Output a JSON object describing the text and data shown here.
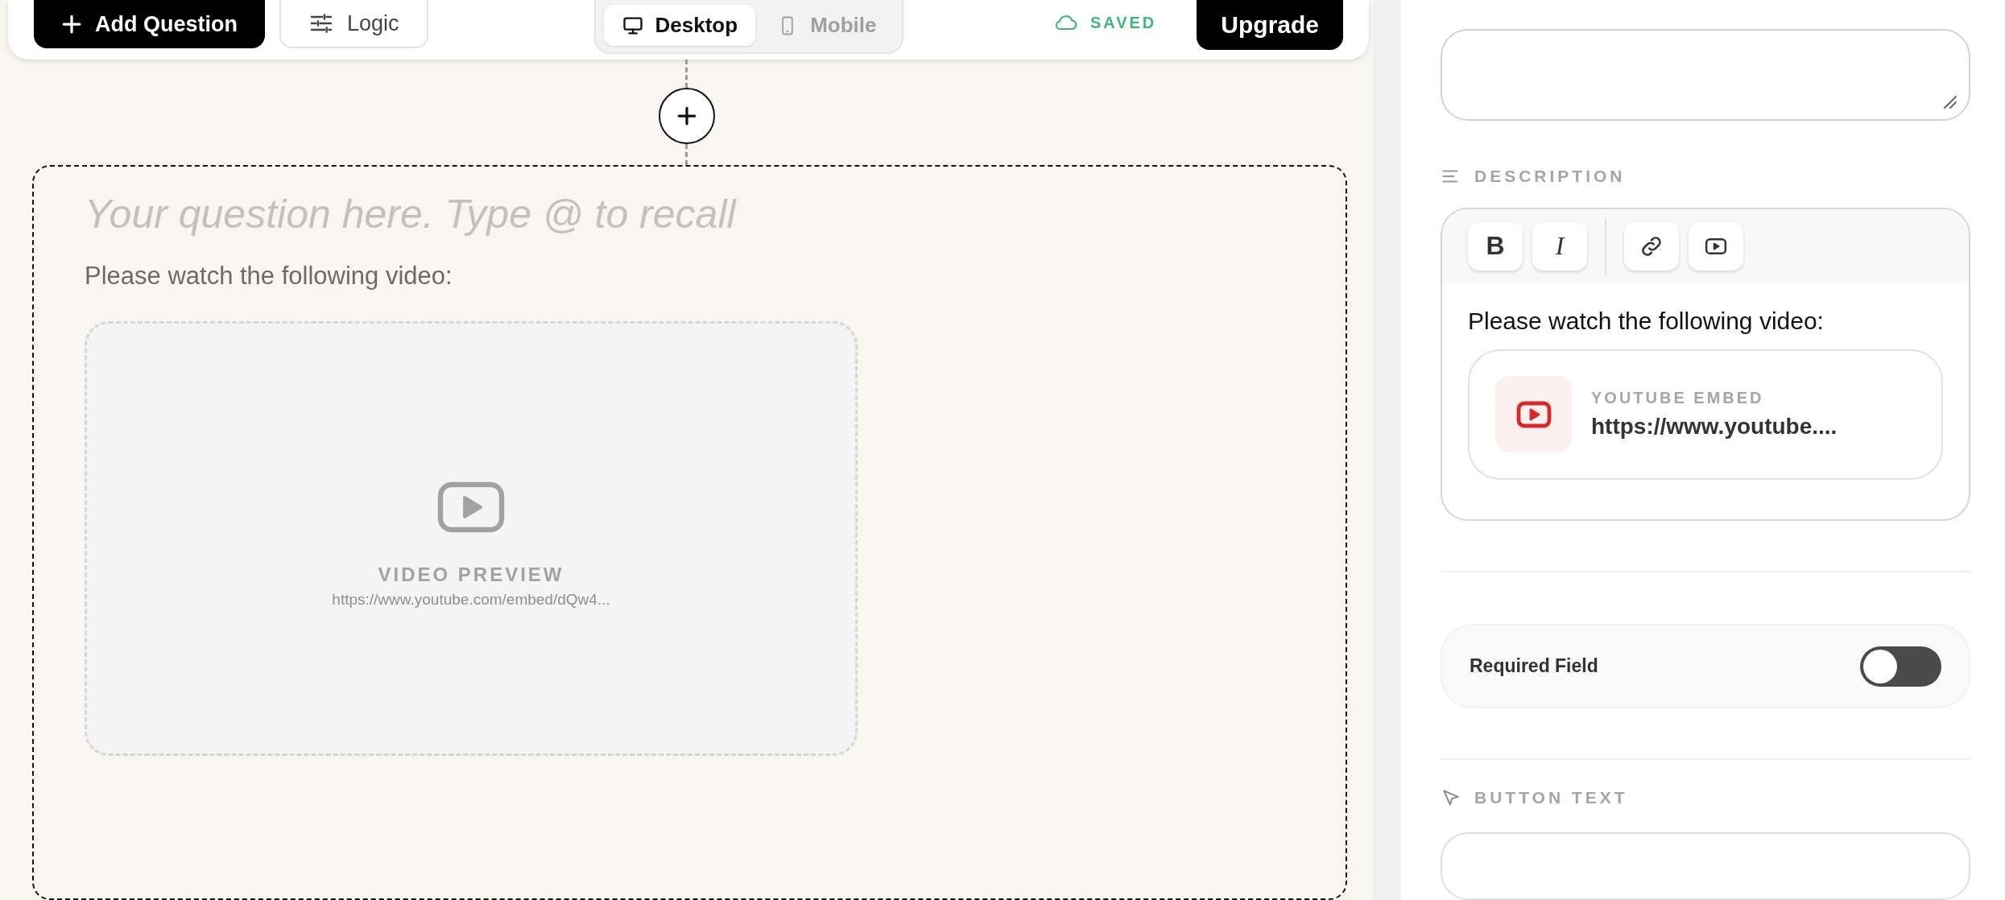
{
  "toolbar": {
    "buttons": [
      {
        "label": "Add Question",
        "kind": "primary"
      },
      {
        "label": "Logic",
        "kind": "secondary"
      }
    ],
    "view_modes": [
      {
        "label": "Desktop",
        "kind": "desktop",
        "selected": true
      },
      {
        "label": "Mobile",
        "kind": "mobile",
        "selected": false
      }
    ],
    "save_status": "SAVED",
    "upgrade": "Upgrade"
  },
  "question": {
    "placeholder": "Your question here. Type @ to recall",
    "description": "Please watch the following video:",
    "video_preview": {
      "label": "VIDEO PREVIEW",
      "url": "https://www.youtube.com/embed/dQw4..."
    }
  },
  "settings": {
    "description": {
      "label": "DESCRIPTION",
      "format_buttons": [
        {
          "kind": "bold",
          "label": "B"
        },
        {
          "kind": "italic",
          "label": "I"
        },
        {
          "kind": "link"
        },
        {
          "kind": "video"
        }
      ],
      "text": "Please watch the following video:",
      "embed": {
        "label": "YOUTUBE EMBED",
        "url": "https://www.youtube...."
      }
    },
    "required_field": {
      "label": "Required Field",
      "on": false
    },
    "button_text": {
      "label": "BUTTON TEXT"
    }
  }
}
